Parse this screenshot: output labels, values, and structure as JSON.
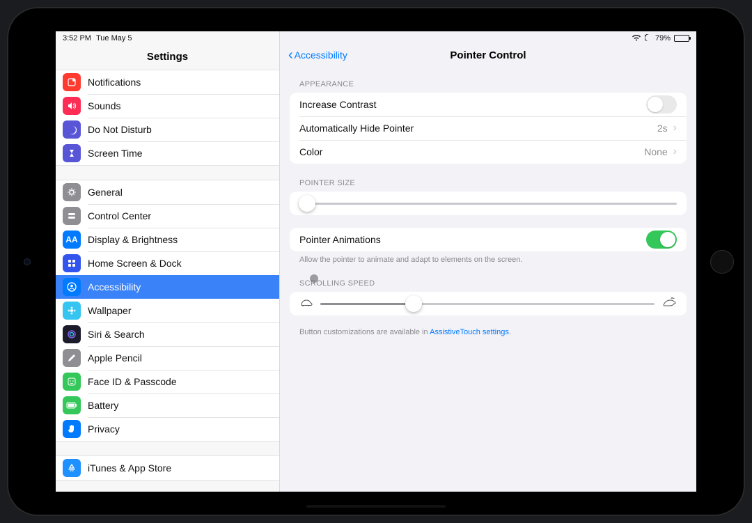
{
  "status": {
    "time": "3:52 PM",
    "date": "Tue May 5",
    "battery_pct": "79%"
  },
  "sidebar": {
    "title": "Settings",
    "groups": [
      [
        {
          "id": "notifications",
          "label": "Notifications",
          "icon": "bell",
          "bg": "#ff3b30"
        },
        {
          "id": "sounds",
          "label": "Sounds",
          "icon": "speaker",
          "bg": "#ff2d55"
        },
        {
          "id": "dnd",
          "label": "Do Not Disturb",
          "icon": "moon",
          "bg": "#5856d6"
        },
        {
          "id": "screentime",
          "label": "Screen Time",
          "icon": "hourglass",
          "bg": "#5856d6"
        }
      ],
      [
        {
          "id": "general",
          "label": "General",
          "icon": "gear",
          "bg": "#8e8e93"
        },
        {
          "id": "controlcenter",
          "label": "Control Center",
          "icon": "switches",
          "bg": "#8e8e93"
        },
        {
          "id": "display",
          "label": "Display & Brightness",
          "icon": "aa",
          "bg": "#007aff"
        },
        {
          "id": "homescreen",
          "label": "Home Screen & Dock",
          "icon": "grid",
          "bg": "#3355ee"
        },
        {
          "id": "accessibility",
          "label": "Accessibility",
          "icon": "person",
          "bg": "#007aff",
          "selected": true
        },
        {
          "id": "wallpaper",
          "label": "Wallpaper",
          "icon": "flower",
          "bg": "#36c5f0"
        },
        {
          "id": "siri",
          "label": "Siri & Search",
          "icon": "siri",
          "bg": "#1b1b2b"
        },
        {
          "id": "applepencil",
          "label": "Apple Pencil",
          "icon": "pencil",
          "bg": "#8e8e93"
        },
        {
          "id": "faceid",
          "label": "Face ID & Passcode",
          "icon": "face",
          "bg": "#34c759"
        },
        {
          "id": "battery",
          "label": "Battery",
          "icon": "battery",
          "bg": "#34c759"
        },
        {
          "id": "privacy",
          "label": "Privacy",
          "icon": "hand",
          "bg": "#007aff"
        }
      ],
      [
        {
          "id": "itunes",
          "label": "iTunes & App Store",
          "icon": "appstore",
          "bg": "#1e90ff"
        }
      ]
    ]
  },
  "detail": {
    "back_label": "Accessibility",
    "title": "Pointer Control",
    "appearance_header": "APPEARANCE",
    "increase_contrast_label": "Increase Contrast",
    "increase_contrast_on": false,
    "auto_hide_label": "Automatically Hide Pointer",
    "auto_hide_value": "2s",
    "color_label": "Color",
    "color_value": "None",
    "pointer_size_header": "POINTER SIZE",
    "pointer_size_value_pct": 2,
    "pointer_animations_label": "Pointer Animations",
    "pointer_animations_on": true,
    "pointer_animations_note": "Allow the pointer to animate and adapt to elements on the screen.",
    "scrolling_header": "SCROLLING SPEED",
    "scrolling_value_pct": 28,
    "footer_prefix": "Button customizations are available in ",
    "footer_link": "AssistiveTouch settings",
    "footer_suffix": "."
  }
}
